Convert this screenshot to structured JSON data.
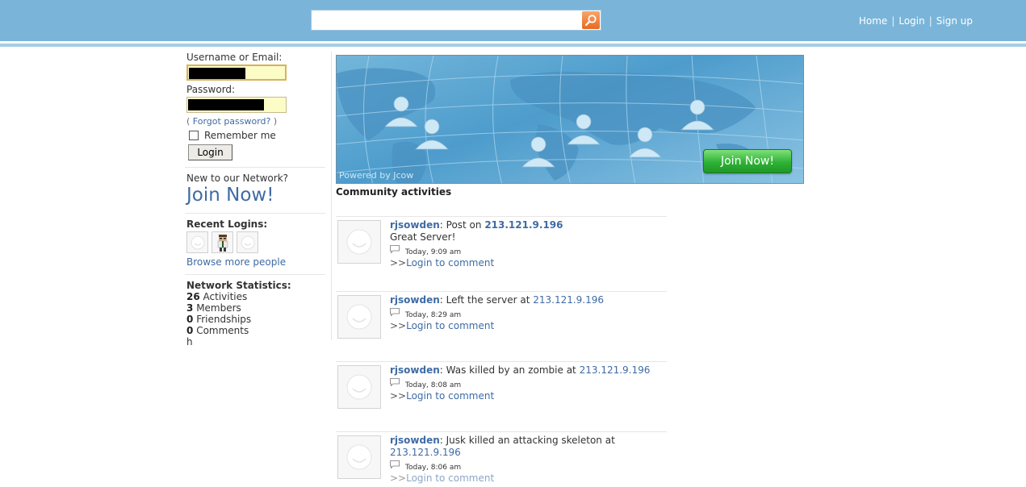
{
  "header": {
    "search": {
      "value": "",
      "placeholder": ""
    },
    "nav": [
      {
        "label": "Home"
      },
      {
        "label": "Login"
      },
      {
        "label": "Sign up"
      }
    ],
    "separator": "|"
  },
  "login": {
    "username_label": "Username or Email:",
    "password_label": "Password:",
    "forgot_open": "(",
    "forgot_label": "Forgot password?",
    "forgot_close": ")",
    "remember_label": "Remember me",
    "login_button": "Login"
  },
  "join": {
    "prompt": "New to our Network?",
    "link": "Join Now!"
  },
  "recent": {
    "title": "Recent Logins:",
    "browse_more": "Browse more people"
  },
  "stats": {
    "title": "Network Statistics:",
    "items": [
      {
        "count": "26",
        "label": "Activities"
      },
      {
        "count": "3",
        "label": "Members"
      },
      {
        "count": "0",
        "label": "Friendships"
      },
      {
        "count": "0",
        "label": "Comments"
      }
    ],
    "trailing": "h"
  },
  "banner": {
    "powered_by": "Powered by Jcow",
    "join_button": "Join Now!"
  },
  "community": {
    "title": "Community activities",
    "login_prefix": ">>",
    "login_comment": "Login to comment",
    "activities": [
      {
        "user": "rjsowden",
        "action": ": Post on ",
        "ip": "213.121.9.196",
        "message": "Great Server!",
        "time": "Today, 9:09 am"
      },
      {
        "user": "rjsowden",
        "action": ": Left the server at ",
        "ip": "213.121.9.196",
        "message": "",
        "time": "Today, 8:29 am"
      },
      {
        "user": "rjsowden",
        "action": ": Was killed by an zombie at ",
        "ip": "213.121.9.196",
        "message": "",
        "time": "Today, 8:08 am"
      },
      {
        "user": "rjsowden",
        "action": ": Jusk killed an attacking skeleton at ",
        "ip": "213.121.9.196",
        "message": "",
        "time": "Today, 8:06 am"
      }
    ]
  }
}
